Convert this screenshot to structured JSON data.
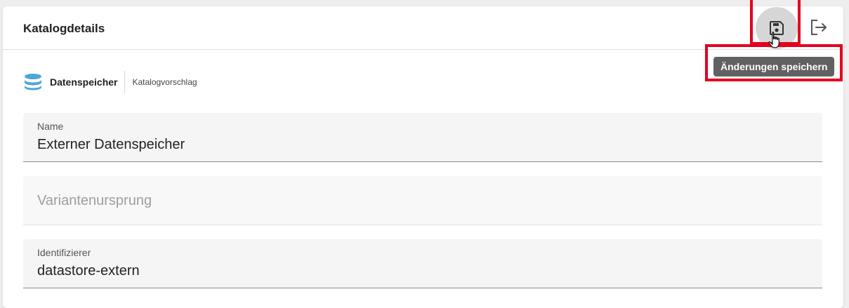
{
  "card": {
    "title": "Katalogdetails",
    "actions": {
      "save_icon": "floppy-disk-icon",
      "exit_icon": "exit-icon",
      "tooltip": "Änderungen speichern"
    }
  },
  "meta": {
    "icon": "database-icon",
    "label": "Datenspeicher",
    "sublabel": "Katalogvorschlag"
  },
  "fields": [
    {
      "label": "Name",
      "value": "Externer Datenspeicher"
    },
    {
      "placeholder": "Variantenursprung"
    },
    {
      "label": "Identifizierer",
      "value": "datastore-extern"
    }
  ],
  "colors": {
    "highlight": "#e4001e",
    "accent": "#4ea6d8",
    "tooltip_bg": "#616161"
  }
}
